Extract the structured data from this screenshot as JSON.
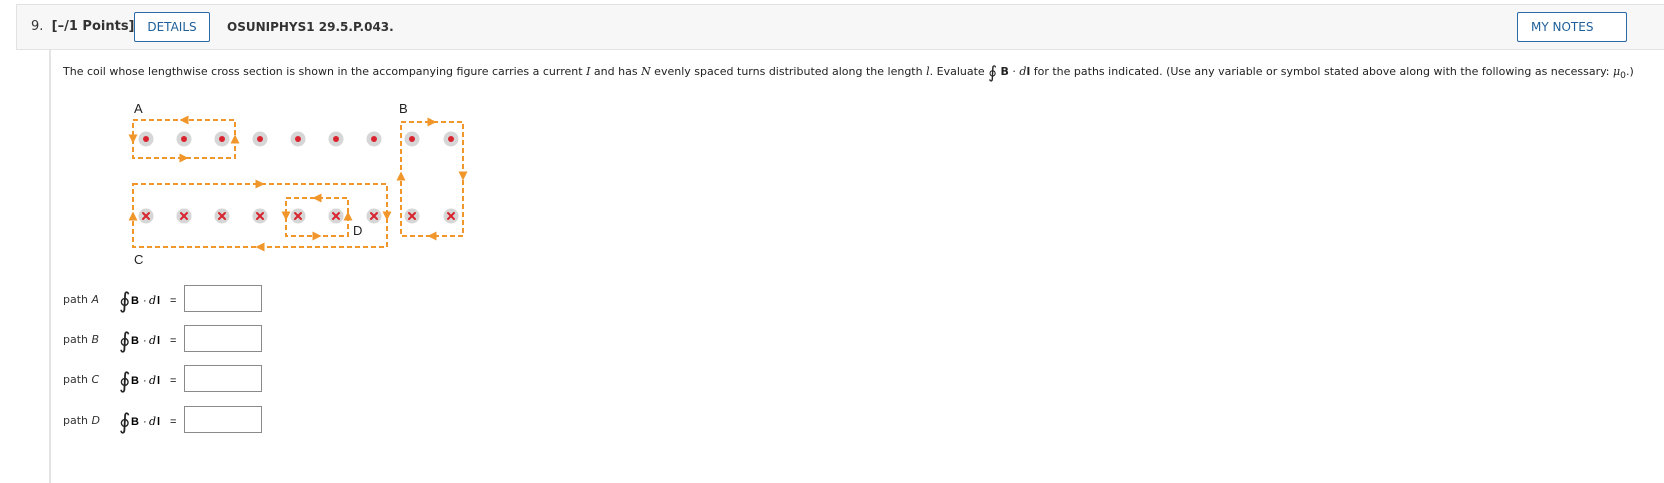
{
  "header": {
    "question_number": "9.",
    "points": "[–/1 Points]",
    "details_label": "DETAILS",
    "question_id": "OSUNIPHYS1 29.5.P.043.",
    "my_notes_label": "MY NOTES"
  },
  "prompt": {
    "text_1": "The coil whose lengthwise cross section is shown in the accompanying figure carries a current ",
    "var_current": "I",
    "text_2": " and has ",
    "var_turns": "N",
    "text_3": " evenly spaced turns distributed along the length ",
    "var_length": "l",
    "text_4": ". Evaluate ",
    "text_5": " for the paths indicated. (Use any variable or symbol stated above along with the following as necessary: ",
    "mu": "μ",
    "mu_sub": "0",
    "text_6": ".)"
  },
  "figure": {
    "label_a": "A",
    "label_b": "B",
    "label_c": "C",
    "label_d": "D",
    "path_color": "#f0962a",
    "dot_color": "#d9232e",
    "wire_color": "#d6d6d6"
  },
  "integral_symbol": "∮",
  "integral_B": "B",
  "integral_dot": "·",
  "integral_d": "d",
  "integral_l": "l",
  "integral_equals": "=",
  "answers": [
    {
      "path_word": "path ",
      "path_letter": "A",
      "value": ""
    },
    {
      "path_word": "path ",
      "path_letter": "B",
      "value": ""
    },
    {
      "path_word": "path ",
      "path_letter": "C",
      "value": ""
    },
    {
      "path_word": "path ",
      "path_letter": "D",
      "value": ""
    }
  ]
}
